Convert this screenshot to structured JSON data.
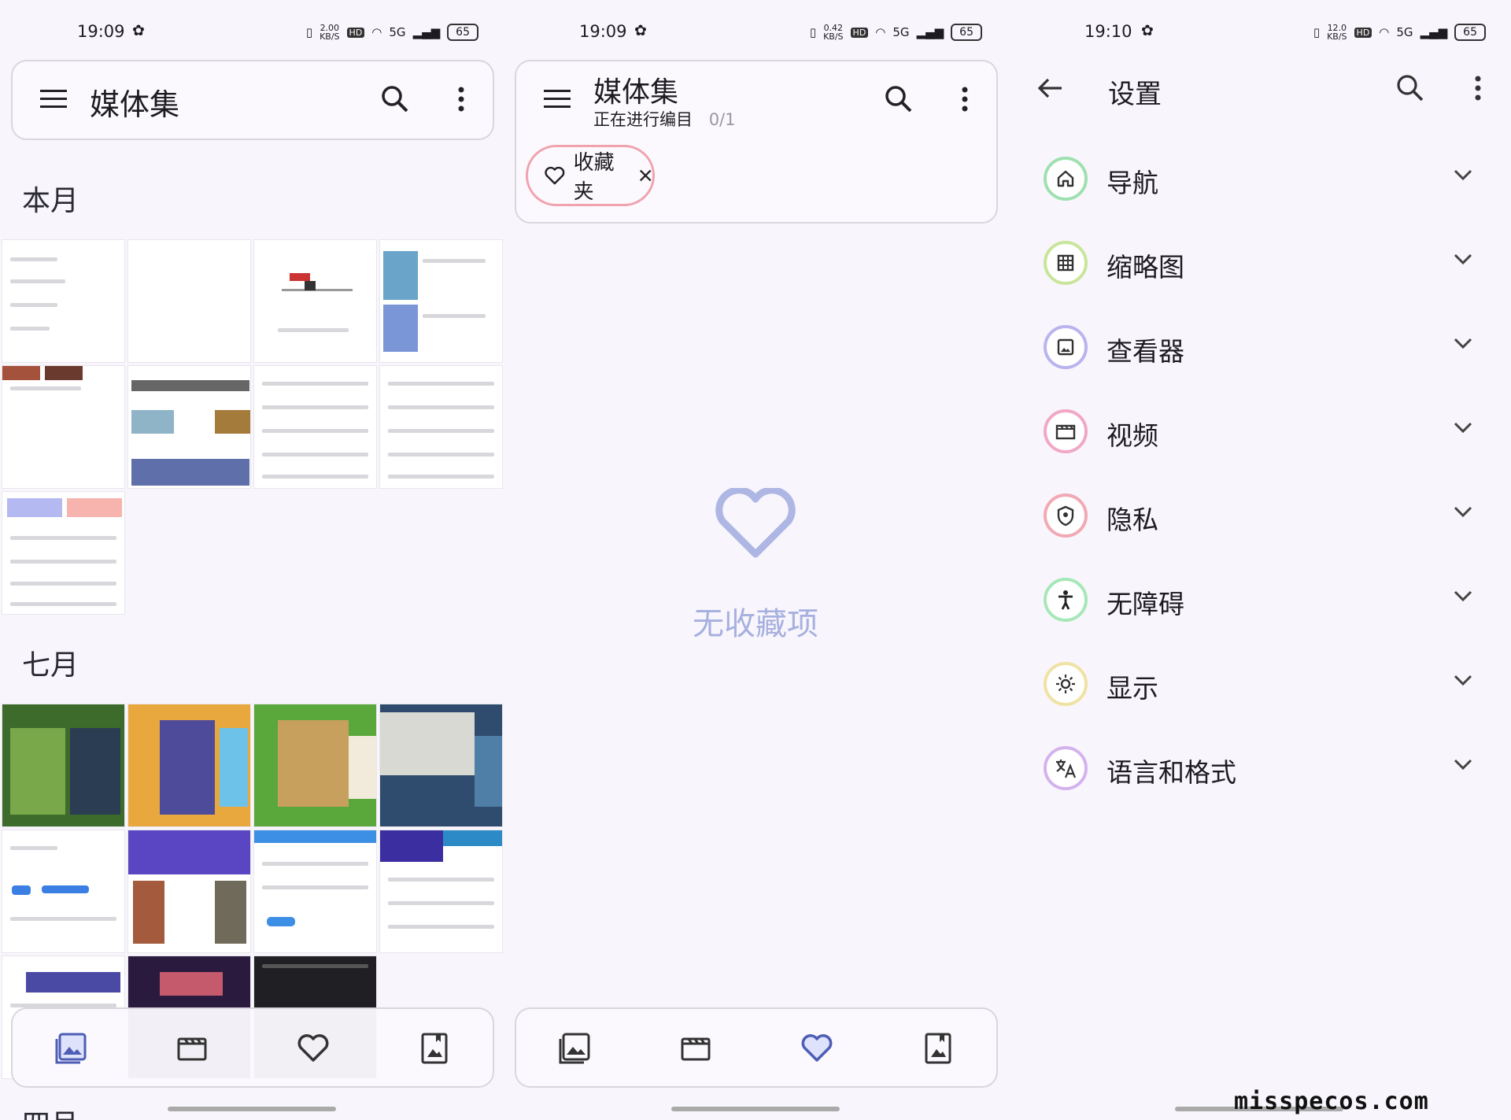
{
  "panel1": {
    "time": "19:09",
    "speed": "2.00",
    "speed_unit": "KB/S",
    "hd": "HD",
    "net": "5G",
    "battery": "65",
    "title": "媒体集",
    "section_month": "本月",
    "section_july": "七月",
    "section_next": "四月"
  },
  "panel2": {
    "time": "19:09",
    "speed": "0.42",
    "speed_unit": "KB/S",
    "hd": "HD",
    "net": "5G",
    "battery": "65",
    "title": "媒体集",
    "subtitle": "正在进行编目",
    "progress": "0/1",
    "chip_label": "收藏夹",
    "empty_text": "无收藏项"
  },
  "panel3": {
    "time": "19:10",
    "speed": "12.0",
    "speed_unit": "KB/S",
    "hd": "HD",
    "net": "5G",
    "battery": "65",
    "title": "设置",
    "items": [
      {
        "label": "导航",
        "icon": "home-icon",
        "color": "#9fe0b0"
      },
      {
        "label": "缩略图",
        "icon": "grid-icon",
        "color": "#c9e59a"
      },
      {
        "label": "查看器",
        "icon": "image-icon",
        "color": "#b9b4ee"
      },
      {
        "label": "视频",
        "icon": "movie-icon",
        "color": "#f1a7c6"
      },
      {
        "label": "隐私",
        "icon": "shield-icon",
        "color": "#f2a9b4"
      },
      {
        "label": "无障碍",
        "icon": "accessibility-icon",
        "color": "#a6e7b8"
      },
      {
        "label": "显示",
        "icon": "brightness-icon",
        "color": "#efe2a2"
      },
      {
        "label": "语言和格式",
        "icon": "translate-icon",
        "color": "#d5b2ee"
      }
    ]
  },
  "watermark": "misspecos.com"
}
